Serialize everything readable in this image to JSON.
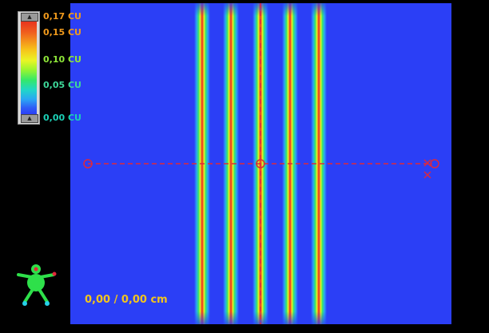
{
  "legend": {
    "labels": [
      "0,17 CU",
      "0,15 CU",
      "0,10 CU",
      "0,05 CU",
      "0,00 CU"
    ],
    "up_button": "▲",
    "down_button": "▲"
  },
  "readout": {
    "coordinates": "0,00 /  0,00 cm"
  },
  "colors": {
    "background": "#000000",
    "field": "#2b3ff6",
    "peak": "#e8341e",
    "marker_line": "#e0283a",
    "readout": "#f3c51c"
  },
  "icons": {
    "orientation": "patient-orientation-figure-icon",
    "profile_start": "circle-marker-icon",
    "profile_end": "cross-marker-icon"
  }
}
